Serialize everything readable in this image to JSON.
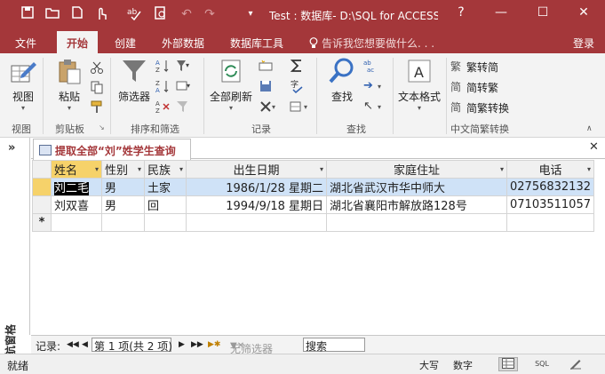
{
  "titlebar": {
    "title": "Test : 数据库- D:\\SQL for ACCESS...",
    "help": "?",
    "minimize": "—",
    "maximize": "☐",
    "close": "✕",
    "accent": "#a4373a"
  },
  "menu": {
    "file": "文件",
    "home": "开始",
    "create": "创建",
    "external": "外部数据",
    "dbtools": "数据库工具",
    "tellme": "告诉我您想要做什么. . .",
    "login": "登录"
  },
  "ribbon": {
    "view_btn": "视图",
    "group_view": "视图",
    "paste_btn": "粘贴",
    "group_clipboard": "剪贴板",
    "filter_btn": "筛选器",
    "group_sort": "排序和筛选",
    "refresh_btn": "全部刷新",
    "group_records": "记录",
    "find_btn": "查找",
    "group_find": "查找",
    "textformat_btn": "文本格式",
    "trad_btn": "繁转简",
    "simp_btn": "简转繁",
    "convert_btn": "简繁转换",
    "group_chinese": "中文简繁转换"
  },
  "navpane": {
    "toggle": "»",
    "label": "导航窗格"
  },
  "document": {
    "tab_title": "提取全部“刘”姓学生查询",
    "close": "✕"
  },
  "table": {
    "columns": [
      "姓名",
      "性别",
      "民族",
      "出生日期",
      "家庭住址",
      "电话"
    ],
    "rows": [
      [
        "刘二毛",
        "男",
        "土家",
        "1986/1/28 星期二",
        "湖北省武汉市华中师大",
        "02756832132"
      ],
      [
        "刘双喜",
        "男",
        "回",
        "1994/9/18 星期日",
        "湖北省襄阳市解放路128号",
        "07103511057"
      ]
    ],
    "new_row_marker": "*"
  },
  "recordnav": {
    "label": "记录:",
    "first": "◀◀",
    "prev": "◀",
    "position": "第 1 项(共 2 项)",
    "next": "▶",
    "last": "▶▶",
    "new": "▶✱",
    "filter": "无筛选器",
    "search": "搜索"
  },
  "status": {
    "ready": "就绪",
    "caps": "大写",
    "num": "数字"
  }
}
